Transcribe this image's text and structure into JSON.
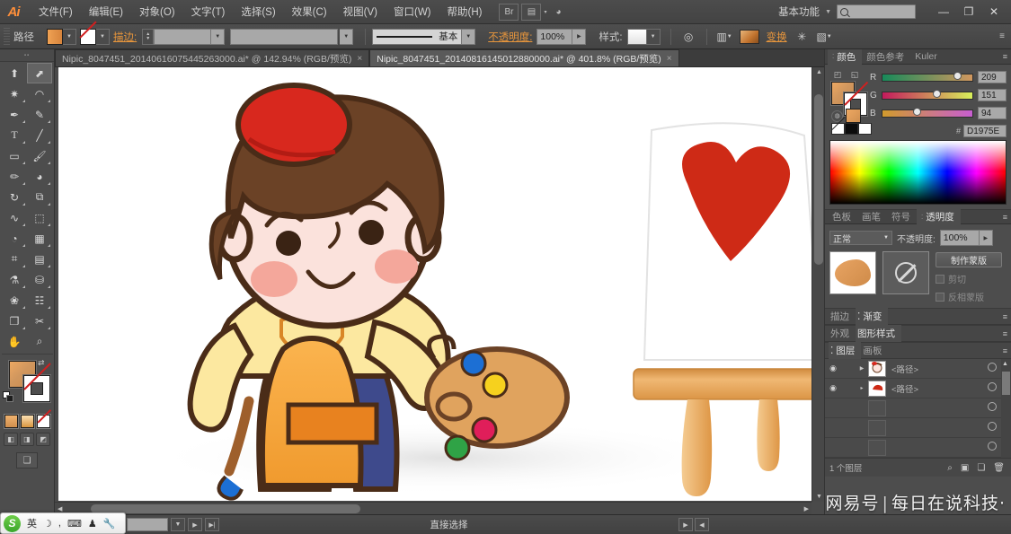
{
  "app": {
    "name": "Adobe Illustrator",
    "logo": "Ai"
  },
  "menubar": {
    "items": [
      {
        "label": "文件(F)",
        "name": "menu-file"
      },
      {
        "label": "编辑(E)",
        "name": "menu-edit"
      },
      {
        "label": "对象(O)",
        "name": "menu-object"
      },
      {
        "label": "文字(T)",
        "name": "menu-type"
      },
      {
        "label": "选择(S)",
        "name": "menu-select"
      },
      {
        "label": "效果(C)",
        "name": "menu-effect"
      },
      {
        "label": "视图(V)",
        "name": "menu-view"
      },
      {
        "label": "窗口(W)",
        "name": "menu-window"
      },
      {
        "label": "帮助(H)",
        "name": "menu-help"
      }
    ],
    "bridge_icon": "bridge-icon",
    "arrange_icon": "arrange-documents-icon",
    "stock_icon": "stock-icon",
    "workspace": "基本功能",
    "search_placeholder": "",
    "search_value": "",
    "window_buttons": {
      "minimize": "—",
      "restore": "❐",
      "close": "✕"
    }
  },
  "controlbar": {
    "object_label": "路径",
    "fill_label": "fill-swatch",
    "stroke_label": "stroke-swatch",
    "stroke_text": "描边:",
    "stroke_weight": "",
    "stroke_profile": "",
    "brush_label": "基本",
    "opacity_label": "不透明度:",
    "opacity_value": "100%",
    "style_label": "样式:",
    "transform_label": "变换",
    "recolor_icon": "recolor-artwork-icon",
    "align_icon": "align-icon",
    "isolate_icon": "isolate-icon",
    "panel_menu": "panel-menu-icon"
  },
  "toolbar": {
    "tools": [
      {
        "name": "selection-tool",
        "glyph": "⬆",
        "selected": false
      },
      {
        "name": "direct-selection-tool",
        "glyph": "⬈",
        "selected": true
      },
      {
        "name": "magic-wand-tool",
        "glyph": "✷",
        "selected": false
      },
      {
        "name": "lasso-tool",
        "glyph": "❀",
        "selected": false
      },
      {
        "name": "pen-tool",
        "glyph": "✒",
        "selected": false
      },
      {
        "name": "add-anchor-point-tool",
        "glyph": "✐",
        "selected": false
      },
      {
        "name": "type-tool",
        "glyph": "T",
        "selected": false
      },
      {
        "name": "line-segment-tool",
        "glyph": "╱",
        "selected": false
      },
      {
        "name": "rectangle-tool",
        "glyph": "▭",
        "selected": false
      },
      {
        "name": "paintbrush-tool",
        "glyph": "✎",
        "selected": false
      },
      {
        "name": "pencil-tool",
        "glyph": "✏",
        "selected": false
      },
      {
        "name": "blob-brush-tool",
        "glyph": "◕",
        "selected": false
      },
      {
        "name": "rotate-tool",
        "glyph": "↺",
        "selected": false
      },
      {
        "name": "scale-tool",
        "glyph": "⧉",
        "selected": false
      },
      {
        "name": "width-tool",
        "glyph": "∿",
        "selected": false
      },
      {
        "name": "free-transform-tool",
        "glyph": "⬚",
        "selected": false
      },
      {
        "name": "shape-builder-tool",
        "glyph": "◔",
        "selected": false
      },
      {
        "name": "perspective-grid-tool",
        "glyph": "▦",
        "selected": false
      },
      {
        "name": "mesh-tool",
        "glyph": "⌗",
        "selected": false
      },
      {
        "name": "gradient-tool",
        "glyph": "▤",
        "selected": false
      },
      {
        "name": "eyedropper-tool",
        "glyph": "⚗",
        "selected": false
      },
      {
        "name": "blend-tool",
        "glyph": "⛁",
        "selected": false
      },
      {
        "name": "symbol-sprayer-tool",
        "glyph": "✿",
        "selected": false
      },
      {
        "name": "column-graph-tool",
        "glyph": "☷",
        "selected": false
      },
      {
        "name": "artboard-tool",
        "glyph": "❐",
        "selected": false
      },
      {
        "name": "slice-tool",
        "glyph": "✂",
        "selected": false
      },
      {
        "name": "hand-tool",
        "glyph": "✋",
        "selected": false
      },
      {
        "name": "zoom-tool",
        "glyph": "⌕",
        "selected": false
      }
    ],
    "fill_color": "#D1975E",
    "stroke_color": "none",
    "swap_icon": "swap-fill-stroke-icon",
    "default_icon": "default-fill-stroke-icon",
    "modes": [
      "color-mode",
      "gradient-mode",
      "none-mode"
    ],
    "draw_modes": [
      "draw-normal",
      "draw-behind",
      "draw-inside"
    ],
    "screen_mode": "change-screen-mode"
  },
  "tabs": [
    {
      "title": "Nipic_8047451_20140616075445263000.ai* @ 142.94% (RGB/预览)",
      "active": false,
      "close": "×"
    },
    {
      "title": "Nipic_8047451_20140816145012880000.ai* @ 401.8% (RGB/预览)",
      "active": true,
      "close": "×"
    }
  ],
  "colorpanel": {
    "tabs": [
      {
        "label": "颜色",
        "active": true
      },
      {
        "label": "颜色参考",
        "active": false
      },
      {
        "label": "Kuler",
        "active": false
      }
    ],
    "sliders": [
      {
        "label": "R",
        "value": "209",
        "pct": 82
      },
      {
        "label": "G",
        "value": "151",
        "pct": 59
      },
      {
        "label": "B",
        "value": "94",
        "pct": 37
      }
    ],
    "hex_prefix": "#",
    "hex": "D1975E",
    "fill_color": "#D1975E",
    "menu_icon": "panel-menu-icon"
  },
  "transparency": {
    "tabs": [
      {
        "label": "色板",
        "active": false
      },
      {
        "label": "画笔",
        "active": false
      },
      {
        "label": "符号",
        "active": false
      },
      {
        "label": "透明度",
        "active": true
      }
    ],
    "blend_mode": "正常",
    "opacity_label": "不透明度:",
    "opacity_value": "100%",
    "make_mask_button": "制作蒙版",
    "clip_checkbox": "剪切",
    "invert_checkbox": "反相蒙版",
    "menu_icon": "panel-menu-icon"
  },
  "collapsed_panels": [
    {
      "tabs": [
        {
          "label": "描边",
          "active": false
        },
        {
          "label": "渐变",
          "active": true
        }
      ],
      "name": "stroke-gradient-panel"
    },
    {
      "tabs": [
        {
          "label": "外观",
          "active": false
        },
        {
          "label": "图形样式",
          "active": true
        }
      ],
      "name": "appearance-graphicstyles-panel"
    },
    {
      "tabs": [
        {
          "label": "图层",
          "active": true
        },
        {
          "label": "画板",
          "active": false
        }
      ],
      "name": "layers-artboards-panel"
    }
  ],
  "layers": {
    "rows": [
      {
        "name": "<路径>",
        "expandable": true,
        "visible": true,
        "locked": false
      },
      {
        "name": "<路径>",
        "expandable": false,
        "visible": true,
        "locked": false
      },
      {
        "name": "",
        "expandable": false,
        "visible": false,
        "locked": false
      },
      {
        "name": "",
        "expandable": false,
        "visible": false,
        "locked": false
      },
      {
        "name": "",
        "expandable": false,
        "visible": false,
        "locked": false
      }
    ],
    "footer_count": "1 个图层",
    "footer_icons": [
      "locate-object-icon",
      "make-sublayer-icon",
      "new-layer-icon",
      "delete-layer-icon"
    ]
  },
  "statusbar": {
    "zoom_value": "",
    "page_indicator": "",
    "status_text": "直接选择",
    "nav_prev": "◀",
    "nav_next": "▶"
  },
  "ime": {
    "logo": "S",
    "mode": "英",
    "icons": [
      "moon-icon",
      "comma-icon",
      "keyboard-icon",
      "toolbox-icon",
      "wrench-icon"
    ]
  },
  "watermark": {
    "source": "网易号",
    "separator": "|",
    "channel": "每日在说科技·"
  },
  "artwork": {
    "description": "卡通小画家插画",
    "colors": {
      "hat": "#D8281E",
      "hair": "#6B4226",
      "skin": "#FBE2DC",
      "blush": "#F4A79B",
      "shirt": "#FCE8A0",
      "apron": "#F5A73C",
      "pants": "#3E4A8C",
      "easel": "#E8A85C",
      "palette": "#E0A35E",
      "heart": "#CE2A16",
      "outline": "#4A2C18"
    },
    "palette_dots": [
      "#1C6FD4",
      "#F6D11E",
      "#E01E5A",
      "#2FA346"
    ]
  }
}
